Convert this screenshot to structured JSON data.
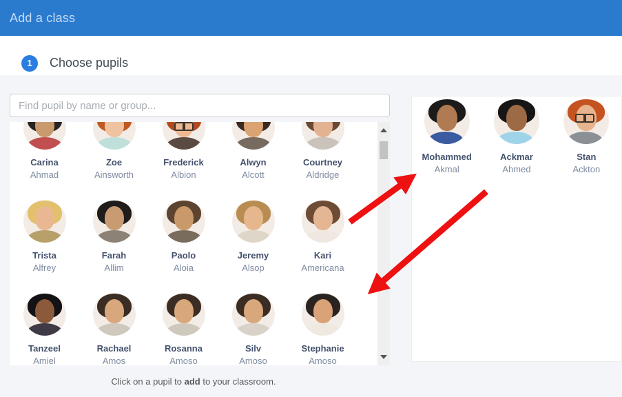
{
  "header": {
    "title": "Add a class",
    "background": "#2a7ace"
  },
  "step": {
    "number": "1",
    "label": "Choose pupils"
  },
  "search": {
    "placeholder": "Find pupil by name or group..."
  },
  "pupil_list": {
    "pupils": [
      {
        "first": "Carina",
        "last": "Ahmad",
        "avatar": {
          "hair": "#2a2320",
          "skin": "#c99a6e",
          "shirt": "#c14f4f",
          "glasses": false
        }
      },
      {
        "first": "Zoe",
        "last": "Ainsworth",
        "avatar": {
          "hair": "#c05a22",
          "skin": "#efc3a0",
          "shirt": "#bfe0da",
          "glasses": false
        }
      },
      {
        "first": "Frederick",
        "last": "Albion",
        "avatar": {
          "hair": "#b5481d",
          "skin": "#edb992",
          "shirt": "#5a4a42",
          "glasses": true
        }
      },
      {
        "first": "Alwyn",
        "last": "Alcott",
        "avatar": {
          "hair": "#3a2a20",
          "skin": "#d9a372",
          "shirt": "#776a5e",
          "glasses": false
        }
      },
      {
        "first": "Courtney",
        "last": "Aldridge",
        "avatar": {
          "hair": "#6b4a33",
          "skin": "#e3b291",
          "shirt": "#c9c3bb",
          "glasses": false
        }
      },
      {
        "first": "Trista",
        "last": "Alfrey",
        "avatar": {
          "hair": "#e3c06b",
          "skin": "#e9b893",
          "shirt": "#b8a06a",
          "glasses": false
        }
      },
      {
        "first": "Farah",
        "last": "Allim",
        "avatar": {
          "hair": "#1f1c1b",
          "skin": "#c99b72",
          "shirt": "#8c8376",
          "glasses": false
        }
      },
      {
        "first": "Paolo",
        "last": "Aloia",
        "avatar": {
          "hair": "#5d4430",
          "skin": "#c9996a",
          "shirt": "#7a6c5c",
          "glasses": false
        }
      },
      {
        "first": "Jeremy",
        "last": "Alsop",
        "avatar": {
          "hair": "#b98d52",
          "skin": "#e6b68d",
          "shirt": "#ded6c8",
          "glasses": false
        }
      },
      {
        "first": "Kari",
        "last": "Americana",
        "avatar": {
          "hair": "#6d4c35",
          "skin": "#e5b694",
          "shirt": "#efe8e0",
          "glasses": false
        }
      },
      {
        "first": "Tanzeel",
        "last": "Amiel",
        "avatar": {
          "hair": "#141215",
          "skin": "#8a5a3a",
          "shirt": "#3f3a45",
          "glasses": false
        }
      },
      {
        "first": "Rachael",
        "last": "Amos",
        "avatar": {
          "hair": "#3c2d24",
          "skin": "#d8a87c",
          "shirt": "#cfc8bd",
          "glasses": false
        }
      },
      {
        "first": "Rosanna",
        "last": "Amoso",
        "avatar": {
          "hair": "#3c2d24",
          "skin": "#d8a87c",
          "shirt": "#cfc8bd",
          "glasses": false
        }
      },
      {
        "first": "Silv",
        "last": "Amoso",
        "avatar": {
          "hair": "#3c2d24",
          "skin": "#d8a87c",
          "shirt": "#d8d2c8",
          "glasses": false
        }
      },
      {
        "first": "Stephanie",
        "last": "Amoso",
        "avatar": {
          "hair": "#2b2320",
          "skin": "#d9a377",
          "shirt": "#efe9e1",
          "glasses": false
        }
      }
    ]
  },
  "selected_panel": {
    "pupils": [
      {
        "first": "Mohammed",
        "last": "Akmal",
        "avatar": {
          "hair": "#1c1b1a",
          "skin": "#b07b52",
          "shirt": "#3a5ba0",
          "glasses": false
        }
      },
      {
        "first": "Ackmar",
        "last": "Ahmed",
        "avatar": {
          "hair": "#161616",
          "skin": "#9c6b45",
          "shirt": "#9fd4e8",
          "glasses": false
        }
      },
      {
        "first": "Stan",
        "last": "Ackton",
        "avatar": {
          "hair": "#c4531f",
          "skin": "#e8b48e",
          "shirt": "#8a9096",
          "glasses": true
        }
      }
    ]
  },
  "footer": {
    "prefix": "Click on a pupil to ",
    "bold": "add",
    "suffix": " to your classroom."
  },
  "colors": {
    "arrow_red": "#ee1111",
    "accent_blue": "#2b7de0"
  }
}
